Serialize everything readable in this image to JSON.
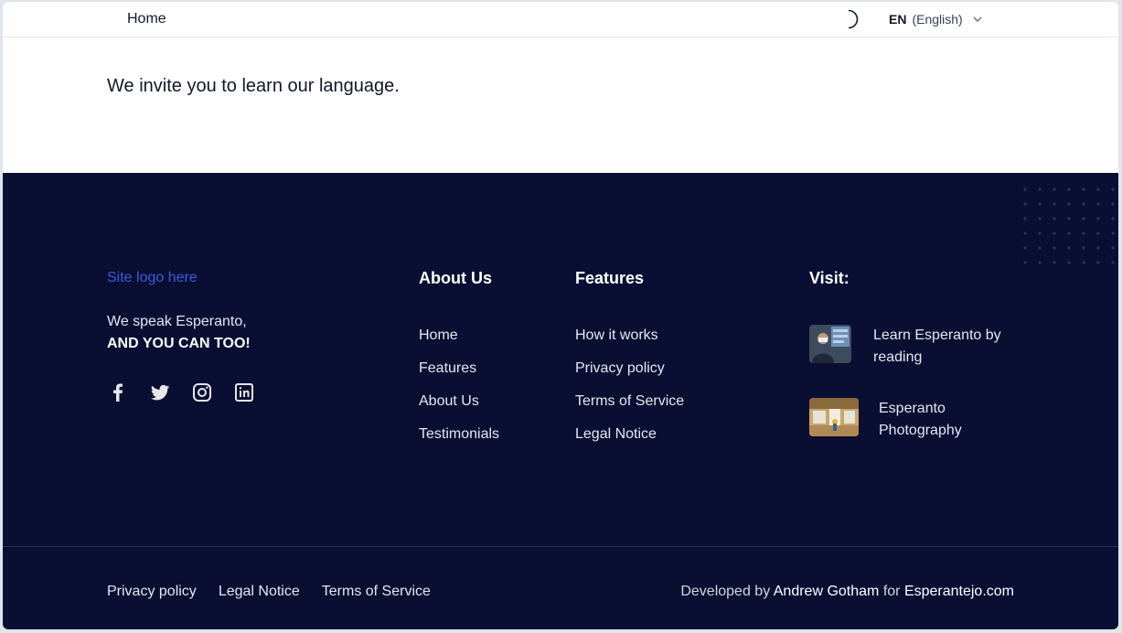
{
  "header": {
    "home_label": "Home",
    "theme_icon": "moon-icon",
    "language": {
      "code": "EN",
      "name": "(English)"
    }
  },
  "main": {
    "intro": "We invite you to learn our language."
  },
  "footer": {
    "logo_text": "Site logo here",
    "tagline_line1": "We speak Esperanto,",
    "tagline_line2": "AND YOU CAN TOO!",
    "social_icons": [
      "facebook-icon",
      "twitter-icon",
      "instagram-icon",
      "linkedin-icon"
    ],
    "about": {
      "title": "About Us",
      "items": [
        "Home",
        "Features",
        "About Us",
        "Testimonials"
      ]
    },
    "features": {
      "title": "Features",
      "items": [
        "How it works",
        "Privacy policy",
        "Terms of Service",
        "Legal Notice"
      ]
    },
    "visit": {
      "title": "Visit:",
      "items": [
        {
          "line1": "Learn Esperanto by",
          "line2": "reading"
        },
        {
          "line1": "Esperanto",
          "line2": "Photography"
        }
      ]
    },
    "bottom_links": [
      "Privacy policy",
      "Legal Notice",
      "Terms of Service"
    ],
    "credit": {
      "prefix": "Developed by",
      "author": "Andrew Gotham",
      "middle": "for",
      "site": "Esperantejo.com"
    }
  },
  "colors": {
    "footer_bg": "#0a0e33",
    "link_blue": "#3b5bdb"
  }
}
